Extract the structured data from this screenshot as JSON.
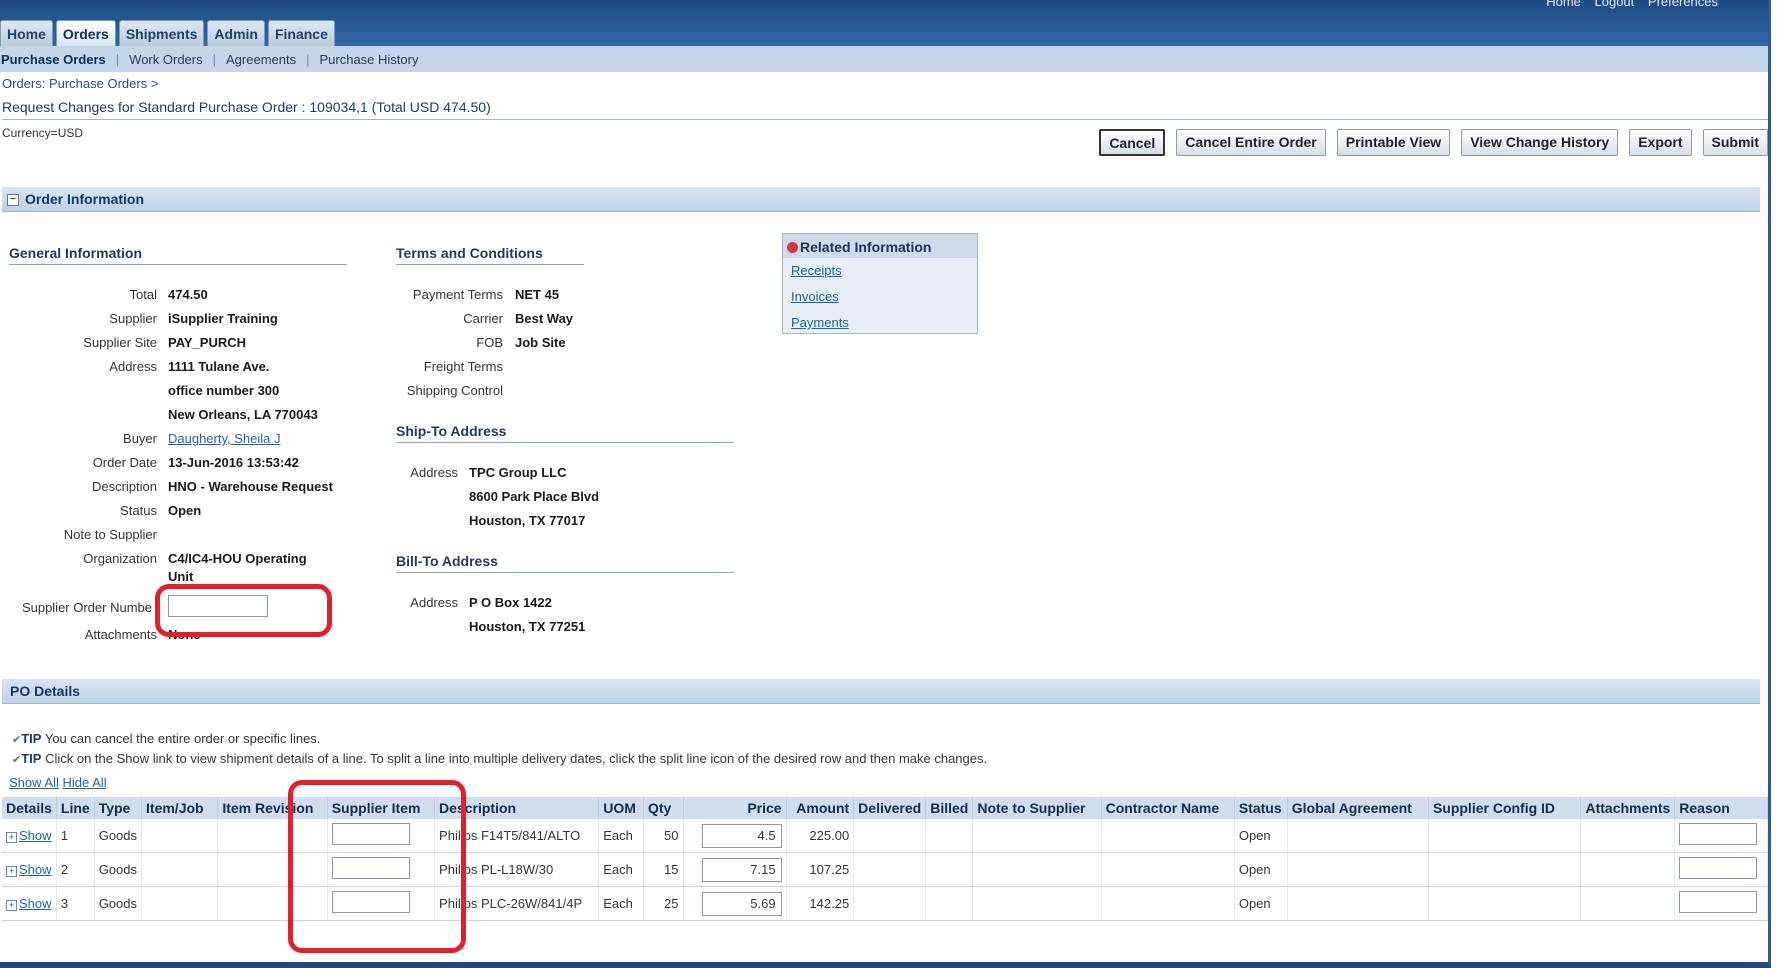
{
  "header": {
    "top_links": [
      "Home",
      "Logout",
      "Preferences"
    ],
    "tabs": [
      "Home",
      "Orders",
      "Shipments",
      "Admin",
      "Finance"
    ],
    "active_tab": "Orders",
    "subnav": [
      "Purchase Orders",
      "Work Orders",
      "Agreements",
      "Purchase History"
    ]
  },
  "breadcrumb": "Orders: Purchase Orders  >",
  "page_title": "Request Changes for Standard Purchase Order : 109034,1 (Total USD 474.50)",
  "currency": "Currency=USD",
  "buttons": {
    "cancel": "Cancel",
    "cancel_entire": "Cancel Entire Order",
    "printable": "Printable View",
    "change_history": "View Change History",
    "export": "Export",
    "submit": "Submit"
  },
  "order_info": {
    "section_title": "Order Information",
    "toggle": "−",
    "general": {
      "title": "General Information",
      "total_label": "Total",
      "total": "474.50",
      "supplier_label": "Supplier",
      "supplier": "iSupplier Training",
      "site_label": "Supplier Site",
      "site": "PAY_PURCH",
      "address_label": "Address",
      "address1": "1111 Tulane Ave.",
      "address2": "office number 300",
      "address3": "New Orleans, LA 770043",
      "buyer_label": "Buyer",
      "buyer": "Daugherty, Sheila J",
      "order_date_label": "Order Date",
      "order_date": "13-Jun-2016 13:53:42",
      "description_label": "Description",
      "description": "HNO - Warehouse Request",
      "status_label": "Status",
      "status": "Open",
      "note_label": "Note to Supplier",
      "org_label": "Organization",
      "org1": "C4/IC4-HOU Operating",
      "org2": "Unit",
      "supplier_order_label": "Supplier Order Numbe",
      "attachments_label": "Attachments",
      "attachments": "None"
    },
    "terms": {
      "title": "Terms and Conditions",
      "payment_terms_label": "Payment Terms",
      "payment_terms": "NET 45",
      "carrier_label": "Carrier",
      "carrier": "Best Way",
      "fob_label": "FOB",
      "fob": "Job Site",
      "freight_label": "Freight Terms",
      "shipping_label": "Shipping Control"
    },
    "ship_to": {
      "title": "Ship-To Address",
      "address_label": "Address",
      "line1": "TPC Group LLC",
      "line2": "8600 Park Place Blvd",
      "line3": "Houston, TX 77017"
    },
    "bill_to": {
      "title": "Bill-To Address",
      "address_label": "Address",
      "line1": "P O Box 1422",
      "line2": "Houston, TX 77251"
    },
    "related": {
      "title": "Related Information",
      "links": [
        "Receipts",
        "Invoices",
        "Payments"
      ]
    }
  },
  "po_details": {
    "section_title": "PO Details",
    "tip_label": "TIP",
    "tip1": "You can cancel the entire order or specific lines.",
    "tip2": "Click on the Show link to view shipment details of a line. To split a line into multiple delivery dates, click the split line icon of the desired row and then make changes.",
    "show_all": "Show All",
    "hide_all": "Hide All",
    "columns": [
      "Details",
      "Line",
      "Type",
      "Item/Job",
      "Item Revision",
      "Supplier Item",
      "Description",
      "UOM",
      "Qty",
      "Price",
      "Amount",
      "Delivered",
      "Billed",
      "Note to Supplier",
      "Contractor Name",
      "Status",
      "Global Agreement",
      "Supplier Config ID",
      "Attachments",
      "Reason"
    ],
    "rows": [
      {
        "details": "Show",
        "line": "1",
        "type": "Goods",
        "description": "Philips F14T5/841/ALTO",
        "uom": "Each",
        "qty": "50",
        "price": "4.5",
        "amount": "225.00",
        "status": "Open"
      },
      {
        "details": "Show",
        "line": "2",
        "type": "Goods",
        "description": "Philips PL-L18W/30",
        "uom": "Each",
        "qty": "15",
        "price": "7.15",
        "amount": "107.25",
        "status": "Open"
      },
      {
        "details": "Show",
        "line": "3",
        "type": "Goods",
        "description": "Philips PLC-26W/841/4P",
        "uom": "Each",
        "qty": "25",
        "price": "5.69",
        "amount": "142.25",
        "status": "Open"
      }
    ]
  },
  "colors": {
    "highlight": "#e0212b",
    "header_blue": "#1e4a82",
    "link": "#1c64a8"
  }
}
